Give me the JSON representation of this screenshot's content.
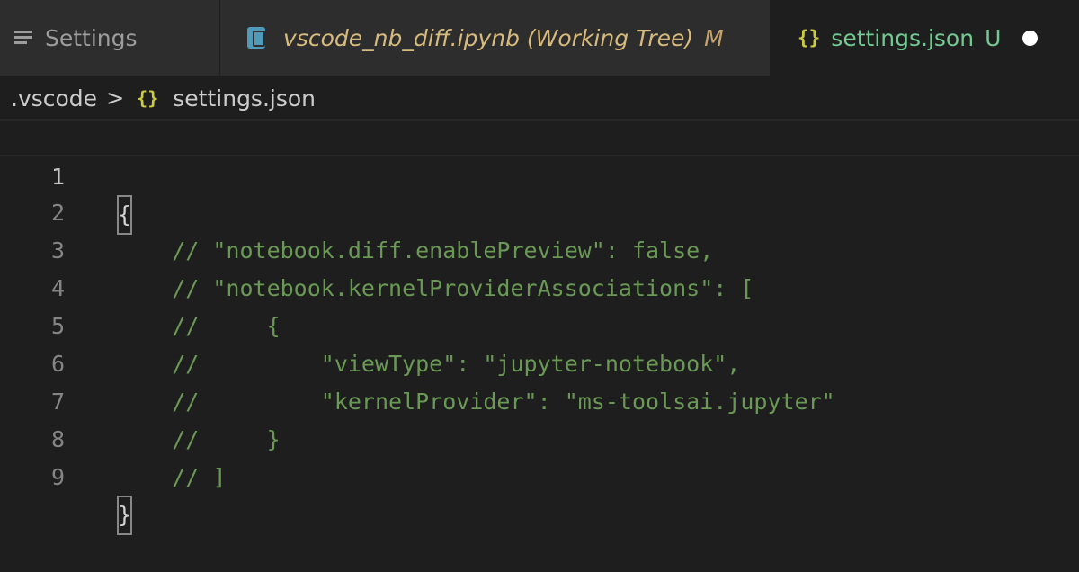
{
  "tabs": [
    {
      "label": "Settings",
      "icon": "lines-icon"
    },
    {
      "label": "vscode_nb_diff.ipynb (Working Tree)",
      "badge": "M",
      "icon": "notebook-icon"
    },
    {
      "label": "settings.json",
      "badge": "U",
      "icon": "braces-icon",
      "active": true,
      "dirty": true
    }
  ],
  "breadcrumb": {
    "folder": ".vscode",
    "separator": ">",
    "icon_text": "{}",
    "file": "settings.json"
  },
  "icon_text": {
    "braces": "{}"
  },
  "editor": {
    "lines": [
      {
        "n": "1",
        "text": "{"
      },
      {
        "n": "2",
        "text": "    // \"notebook.diff.enablePreview\": false,"
      },
      {
        "n": "3",
        "text": "    // \"notebook.kernelProviderAssociations\": ["
      },
      {
        "n": "4",
        "text": "    //     {"
      },
      {
        "n": "5",
        "text": "    //         \"viewType\": \"jupyter-notebook\","
      },
      {
        "n": "6",
        "text": "    //         \"kernelProvider\": \"ms-toolsai.jupyter\""
      },
      {
        "n": "7",
        "text": "    //     }"
      },
      {
        "n": "8",
        "text": "    // ]"
      },
      {
        "n": "9",
        "text": "}"
      }
    ]
  },
  "colors": {
    "comment": "#6a9955",
    "modified": "#d7ba7d",
    "untracked": "#73c991",
    "json_icon": "#cbcb41"
  }
}
